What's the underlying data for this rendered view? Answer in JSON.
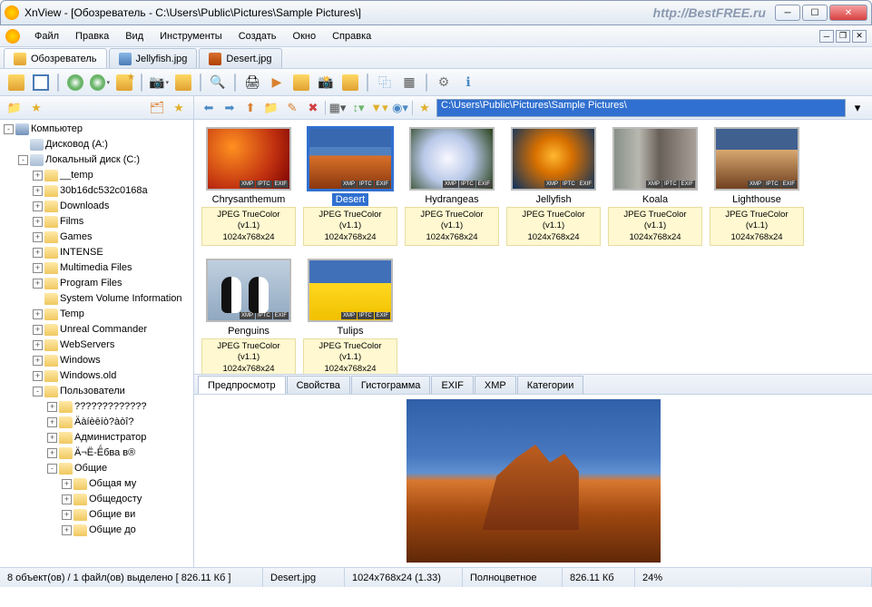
{
  "title": "XnView - [Обозреватель - C:\\Users\\Public\\Pictures\\Sample Pictures\\]",
  "watermark": "http://BestFREE.ru",
  "menu": [
    "Файл",
    "Правка",
    "Вид",
    "Инструменты",
    "Создать",
    "Окно",
    "Справка"
  ],
  "tabs": [
    {
      "label": "Обозреватель",
      "active": true,
      "kind": "br"
    },
    {
      "label": "Jellyfish.jpg",
      "active": false,
      "kind": "img1"
    },
    {
      "label": "Desert.jpg",
      "active": false,
      "kind": "img2"
    }
  ],
  "address": "C:\\Users\\Public\\Pictures\\Sample Pictures\\",
  "tree": {
    "root": "Компьютер",
    "driveA": "Дисковод (A:)",
    "driveC": "Локальный диск (C:)",
    "folders": [
      "__temp",
      "30b16dc532c0168a",
      "Downloads",
      "Films",
      "Games",
      "INTENSE",
      "Multimedia Files",
      "Program Files",
      "System Volume Information",
      "Temp",
      "Unreal Commander",
      "WebServers",
      "Windows",
      "Windows.old",
      "Пользователи"
    ],
    "users_children": [
      "?????????????",
      "Äàíèēíò?àòî?",
      "Администратор",
      "Ä¬Ё-Ё́бва в®",
      "Общие"
    ],
    "public_children": [
      "Общая му",
      "Общедосту",
      "Общие ви",
      "Общие до"
    ]
  },
  "thumbs": [
    {
      "name": "Chrysanthemum",
      "cls": "im-chrys",
      "sel": false
    },
    {
      "name": "Desert",
      "cls": "im-desert",
      "sel": true
    },
    {
      "name": "Hydrangeas",
      "cls": "im-hydra",
      "sel": false
    },
    {
      "name": "Jellyfish",
      "cls": "im-jelly",
      "sel": false
    },
    {
      "name": "Koala",
      "cls": "im-koala",
      "sel": false
    },
    {
      "name": "Lighthouse",
      "cls": "im-light",
      "sel": false
    },
    {
      "name": "Penguins",
      "cls": "im-peng",
      "sel": false
    },
    {
      "name": "Tulips",
      "cls": "im-tulip",
      "sel": false
    }
  ],
  "thumb_meta": {
    "format": "JPEG TrueColor (v1.1)",
    "dims": "1024x768x24"
  },
  "badges": [
    "XMP",
    "IPTC",
    "EXIF"
  ],
  "bottom_tabs": [
    "Предпросмотр",
    "Свойства",
    "Гистограмма",
    "EXIF",
    "XMP",
    "Категории"
  ],
  "status": {
    "count": "8 объект(ов) / 1 файл(ов) выделено  [ 826.11 Кб ]",
    "file": "Desert.jpg",
    "dims": "1024x768x24 (1.33)",
    "color": "Полноцветное",
    "size": "826.11 Кб",
    "zoom": "24%"
  }
}
